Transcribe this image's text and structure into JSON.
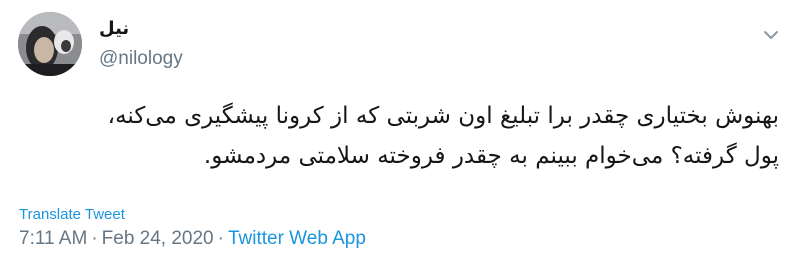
{
  "tweet": {
    "display_name": "نیل",
    "handle": "@nilology",
    "text_lines": [
      "بهنوش بختیاری چقدر برا تبلیغ اون شربتی که از کرونا پیشگیری می‌کنه،",
      "پول گرفته؟ می‌خوام ببینم به چقدر فروخته سلامتی مردمشو."
    ],
    "translate_label": "Translate Tweet",
    "time": "7:11 AM",
    "separator": "·",
    "date": "Feb 24, 2020",
    "source": "Twitter Web App"
  },
  "icons": {
    "menu": "chevron-down-icon",
    "avatar": "avatar"
  },
  "colors": {
    "link": "#1b95e0",
    "muted": "#657786",
    "text": "#14171a"
  }
}
